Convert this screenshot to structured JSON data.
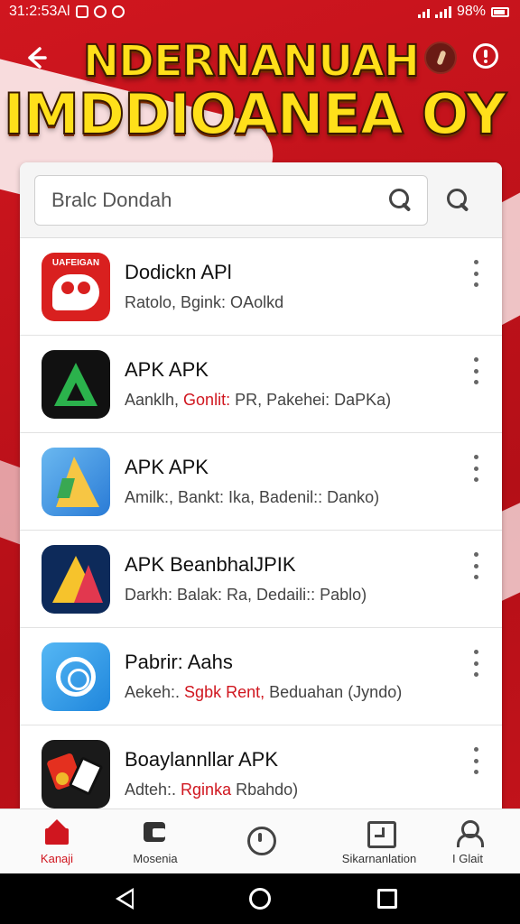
{
  "status_bar": {
    "time": "31:2:53Al",
    "battery": "98%"
  },
  "header": {
    "title_line1": "NDERNANUAH",
    "title_line2": "IMDDIOANEA OY"
  },
  "search": {
    "placeholder": "Bralc Dondah"
  },
  "apps": [
    {
      "icon_text": "UAFEIGAN",
      "name": "Dodickn APl",
      "meta": "Ratolo, Bgink: OAolkd",
      "meta_highlight": ""
    },
    {
      "icon_text": "",
      "name": "APK APK",
      "meta_pre": "Aanklh, ",
      "meta_highlight": "Gonlit:",
      "meta_post": " PR, Pakehei: DaPKa)"
    },
    {
      "icon_text": "",
      "name": "APK APK",
      "meta": "Amilk:, Bankt: Ika, Badenil:: Danko)",
      "meta_highlight": ""
    },
    {
      "icon_text": "",
      "name": "APK BeanbhalJPIK",
      "meta": "Darkh: Balak: Ra, Dedaili:: Pablo)",
      "meta_highlight": ""
    },
    {
      "icon_text": "",
      "name": "Pabrir: Aahs",
      "meta_pre": "Aekeh:. ",
      "meta_highlight": "Sgbk Rent,",
      "meta_post": " Beduahan (Jyndo)"
    },
    {
      "icon_text": "",
      "name": "Boaylannllar APK",
      "meta_pre": "Adteh:. ",
      "meta_highlight": "Rginka",
      "meta_post": " Rbahdo)"
    }
  ],
  "bottom_nav": {
    "home": "Kanaji",
    "categories": "Mosenia",
    "updates": "Sikarnanlation",
    "account": "I Glait"
  },
  "colors": {
    "brand_red": "#d0161f",
    "title_yellow": "#ffe01a"
  }
}
